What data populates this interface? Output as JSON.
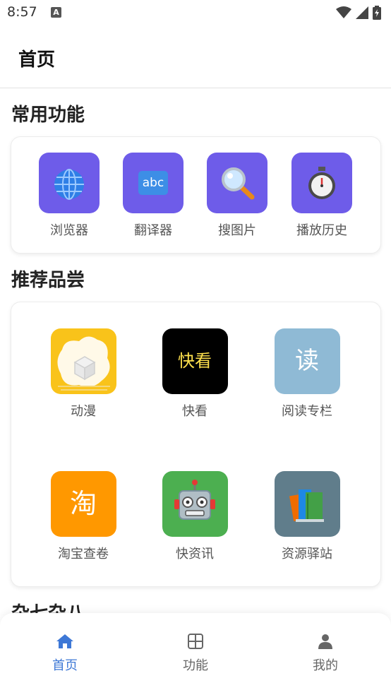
{
  "status": {
    "time": "8:57",
    "notification_glyph": "A"
  },
  "header": {
    "title": "首页"
  },
  "sections": {
    "common": {
      "title": "常用功能",
      "items": [
        {
          "label": "浏览器",
          "icon": "globe-icon"
        },
        {
          "label": "翻译器",
          "icon": "abc-icon",
          "icon_text": "abc"
        },
        {
          "label": "搜图片",
          "icon": "magnifier-icon"
        },
        {
          "label": "播放历史",
          "icon": "stopwatch-icon"
        }
      ],
      "icon_color": "#6e5ce9"
    },
    "recommend": {
      "title": "推荐品尝",
      "items": [
        {
          "label": "动漫",
          "icon": "anime-icon",
          "bg": "#f9c31a"
        },
        {
          "label": "快看",
          "icon": "kuaikan-icon",
          "icon_text": "快看",
          "bg": "#000000"
        },
        {
          "label": "阅读专栏",
          "icon": "read-icon",
          "icon_text": "读",
          "bg": "#8fbad5"
        },
        {
          "label": "淘宝查卷",
          "icon": "taobao-icon",
          "icon_text": "淘",
          "bg": "#ff9800"
        },
        {
          "label": "快资讯",
          "icon": "robot-icon",
          "bg": "#4caf50"
        },
        {
          "label": "资源驿站",
          "icon": "books-icon",
          "bg": "#607d8b"
        }
      ]
    },
    "misc": {
      "title": "杂七杂八"
    }
  },
  "bottom_nav": {
    "active_color": "#3e78d6",
    "inactive_color": "#666666",
    "items": [
      {
        "label": "首页",
        "icon": "home-icon",
        "active": true
      },
      {
        "label": "功能",
        "icon": "grid-icon",
        "active": false
      },
      {
        "label": "我的",
        "icon": "person-icon",
        "active": false
      }
    ]
  }
}
